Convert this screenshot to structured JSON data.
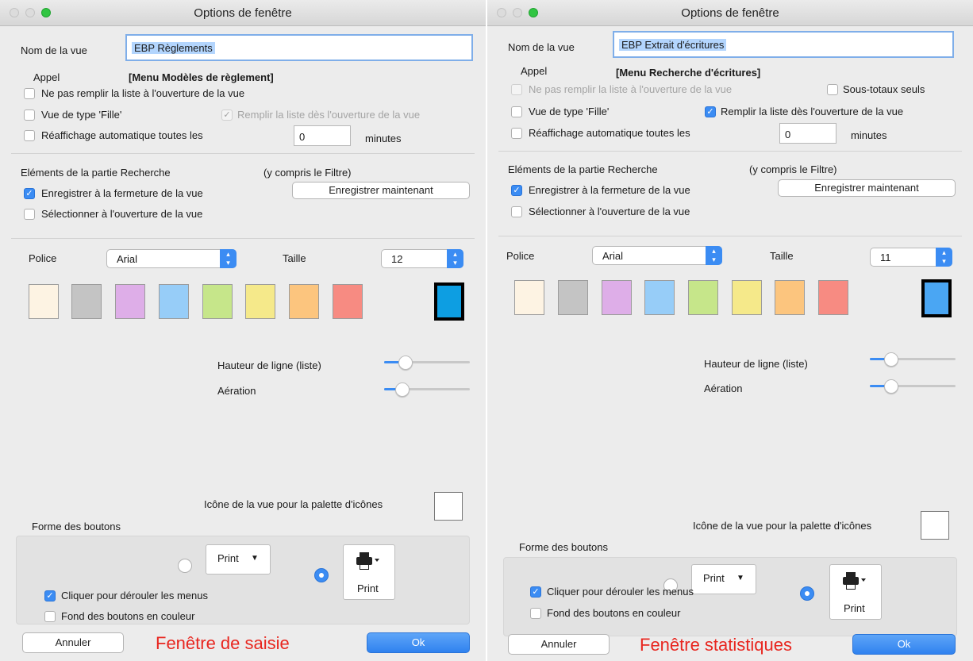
{
  "windows": [
    {
      "title": "Options de fenêtre",
      "view_name_label": "Nom de la vue",
      "view_name_value": "EBP Règlements",
      "appel_label": "Appel",
      "appel_value": "[Menu Modèles de règlement]",
      "cb_no_fill": {
        "label": "Ne pas remplir la liste à l'ouverture de la vue",
        "checked": false,
        "enabled": true
      },
      "cb_subtotals": null,
      "cb_daughter": {
        "label": "Vue de type 'Fille'",
        "checked": false,
        "enabled": true
      },
      "cb_fill": {
        "label": "Remplir la liste dès l'ouverture de la vue",
        "checked": true,
        "enabled": false
      },
      "cb_refresh": {
        "label": "Réaffichage automatique toutes les",
        "checked": false
      },
      "refresh_value": "0",
      "minutes_label": "minutes",
      "search_title": "Eléments de la partie Recherche",
      "search_note": "(y compris le Filtre)",
      "cb_save_close": {
        "label": "Enregistrer à la fermeture de la vue",
        "checked": true
      },
      "cb_select_open": {
        "label": "Sélectionner à l'ouverture de la vue",
        "checked": false
      },
      "save_now_label": "Enregistrer maintenant",
      "font_label": "Police",
      "font_value": "Arial",
      "size_label": "Taille",
      "size_value": "12",
      "swatches": [
        "#fdf3e3",
        "#c4c4c4",
        "#deaee8",
        "#97cdf8",
        "#c6e68a",
        "#f5e98a",
        "#fcc57e",
        "#f78b82"
      ],
      "selected_color": "#0d9ee2",
      "row_height_label": "Hauteur de ligne (liste)",
      "row_height_level": 0.2,
      "spacing_label": "Aération",
      "spacing_level": 0.15,
      "palette_icon_label": "Icône de la vue pour la palette d'icônes",
      "button_shape_label": "Forme des boutons",
      "print_text_label": "Print",
      "print_icon_label": "Print",
      "cb_click_menus": {
        "label": "Cliquer pour dérouler les menus",
        "checked": true
      },
      "cb_colored_bg": {
        "label": "Fond des boutons en couleur",
        "checked": false
      },
      "cancel_label": "Annuler",
      "ok_label": "Ok",
      "caption": "Fenêtre de saisie"
    },
    {
      "title": "Options de fenêtre",
      "view_name_label": "Nom de la vue",
      "view_name_value": "EBP Extrait d'écritures",
      "appel_label": "Appel",
      "appel_value": "[Menu Recherche d'écritures]",
      "cb_no_fill": {
        "label": "Ne pas remplir la liste à l'ouverture de la vue",
        "checked": false,
        "enabled": false
      },
      "cb_subtotals": {
        "label": "Sous-totaux seuls",
        "checked": false
      },
      "cb_daughter": {
        "label": "Vue de type 'Fille'",
        "checked": false,
        "enabled": true
      },
      "cb_fill": {
        "label": "Remplir la liste dès l'ouverture de la vue",
        "checked": true,
        "enabled": true
      },
      "cb_refresh": {
        "label": "Réaffichage automatique toutes les",
        "checked": false
      },
      "refresh_value": "0",
      "minutes_label": "minutes",
      "search_title": "Eléments de la partie Recherche",
      "search_note": "(y compris le Filtre)",
      "cb_save_close": {
        "label": "Enregistrer à la fermeture de la vue",
        "checked": true
      },
      "cb_select_open": {
        "label": "Sélectionner à l'ouverture de la vue",
        "checked": false
      },
      "save_now_label": "Enregistrer maintenant",
      "font_label": "Police",
      "font_value": "Arial",
      "size_label": "Taille",
      "size_value": "11",
      "swatches": [
        "#fdf3e3",
        "#c4c4c4",
        "#deaee8",
        "#97cdf8",
        "#c6e68a",
        "#f5e98a",
        "#fcc57e",
        "#f78b82"
      ],
      "selected_color": "#4aa6f3",
      "row_height_label": "Hauteur de ligne (liste)",
      "row_height_level": 0.2,
      "spacing_label": "Aération",
      "spacing_level": 0.2,
      "palette_icon_label": "Icône de la vue pour la palette d'icônes",
      "button_shape_label": "Forme des boutons",
      "print_text_label": "Print",
      "print_icon_label": "Print",
      "cb_click_menus": {
        "label": "Cliquer pour dérouler les menus",
        "checked": true
      },
      "cb_colored_bg": {
        "label": "Fond des boutons en couleur",
        "checked": false
      },
      "cancel_label": "Annuler",
      "ok_label": "Ok",
      "caption": "Fenêtre statistiques"
    }
  ]
}
